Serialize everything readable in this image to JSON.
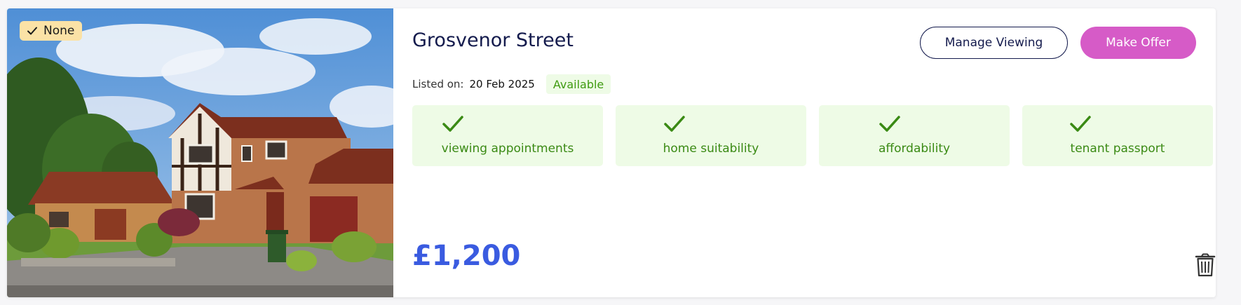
{
  "listing": {
    "match_badge": {
      "label": "None",
      "icon": "check-icon"
    },
    "photo": {
      "alt": "Detached brick house with tudor-style gable and garage"
    },
    "title": "Grosvenor Street",
    "actions": {
      "manage_viewing_label": "Manage Viewing",
      "make_offer_label": "Make Offer"
    },
    "listed_label": "Listed on:",
    "listed_date": "20 Feb 2025",
    "status": "Available",
    "features": [
      {
        "label": "viewing appointments",
        "icon": "check-icon",
        "checked": true
      },
      {
        "label": "home suitability",
        "icon": "check-icon",
        "checked": true
      },
      {
        "label": "affordability",
        "icon": "check-icon",
        "checked": true
      },
      {
        "label": "tenant passport",
        "icon": "check-icon",
        "checked": true
      }
    ],
    "price": "£1,200",
    "delete_icon": "trash-icon"
  },
  "colors": {
    "title": "#141b4d",
    "primary_button": "#d65bc7",
    "status_green": "#3f9b10",
    "feature_bg": "#eefbe6",
    "price": "#3a5be0",
    "badge_bg": "#fbe2a6"
  }
}
